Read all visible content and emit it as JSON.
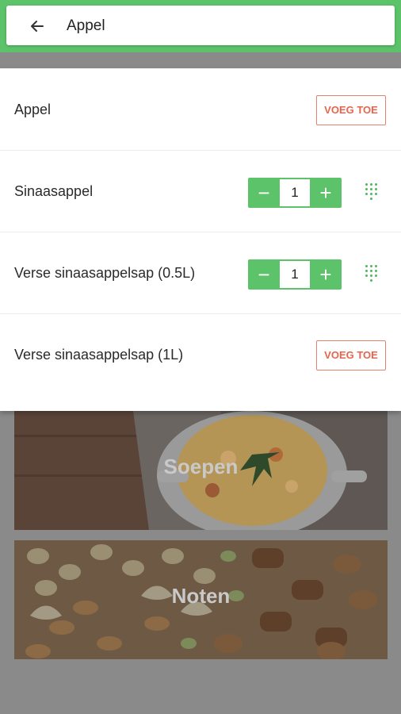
{
  "search": {
    "query": "Appel"
  },
  "results": [
    {
      "label": "Appel",
      "action": "VOEG TOE"
    },
    {
      "label": "Sinaasappel",
      "quantity": "1",
      "minus": "−",
      "plus": "+"
    },
    {
      "label": "Verse sinaasappelsap (0.5L)",
      "quantity": "1",
      "minus": "−",
      "plus": "+"
    },
    {
      "label": "Verse sinaasappelsap (1L)",
      "action": "VOEG TOE"
    }
  ],
  "categories": [
    {
      "label": "Soepen"
    },
    {
      "label": "Noten"
    }
  ],
  "colors": {
    "primary": "#5cc36a",
    "accent": "#e8644c",
    "overlay": "#8a8a8a"
  }
}
